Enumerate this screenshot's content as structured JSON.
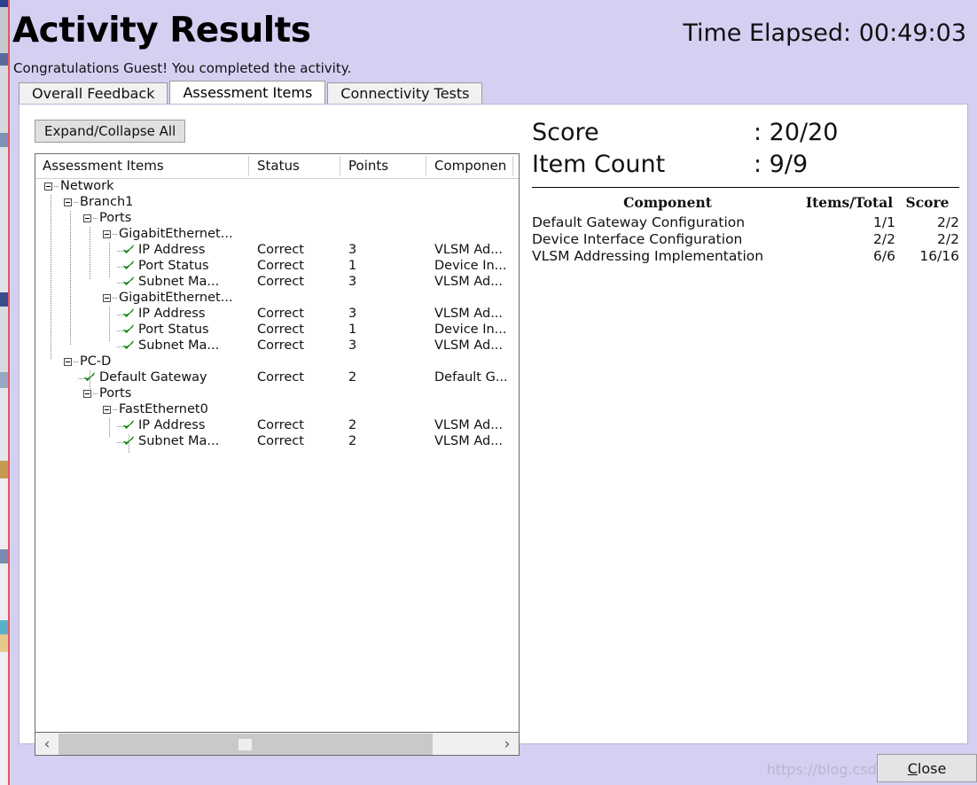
{
  "header": {
    "title": "Activity Results",
    "time_elapsed": "Time Elapsed: 00:49:03",
    "subtitle": "Congratulations Guest! You completed the activity."
  },
  "tabs": [
    {
      "label": "Overall Feedback",
      "active": false
    },
    {
      "label": "Assessment Items",
      "active": true
    },
    {
      "label": "Connectivity Tests",
      "active": false
    }
  ],
  "toolbar": {
    "expand_collapse_label": "Expand/Collapse All"
  },
  "tree": {
    "columns": [
      {
        "label": "Assessment Items"
      },
      {
        "label": "Status"
      },
      {
        "label": "Points"
      },
      {
        "label": "Componen"
      }
    ],
    "rows": [
      {
        "label": "Network",
        "depth": 0,
        "kind": "node"
      },
      {
        "label": "Branch1",
        "depth": 1,
        "kind": "node"
      },
      {
        "label": "Ports",
        "depth": 2,
        "kind": "node"
      },
      {
        "label": "GigabitEthernet...",
        "depth": 3,
        "kind": "node"
      },
      {
        "label": "IP Address",
        "depth": 4,
        "kind": "leaf",
        "status": "Correct",
        "points": "3",
        "component": "VLSM Ad..."
      },
      {
        "label": "Port Status",
        "depth": 4,
        "kind": "leaf",
        "status": "Correct",
        "points": "1",
        "component": "Device In..."
      },
      {
        "label": "Subnet Ma...",
        "depth": 4,
        "kind": "leaf",
        "status": "Correct",
        "points": "3",
        "component": "VLSM Ad..."
      },
      {
        "label": "GigabitEthernet...",
        "depth": 3,
        "kind": "node"
      },
      {
        "label": "IP Address",
        "depth": 4,
        "kind": "leaf",
        "status": "Correct",
        "points": "3",
        "component": "VLSM Ad..."
      },
      {
        "label": "Port Status",
        "depth": 4,
        "kind": "leaf",
        "status": "Correct",
        "points": "1",
        "component": "Device In..."
      },
      {
        "label": "Subnet Ma...",
        "depth": 4,
        "kind": "leaf",
        "status": "Correct",
        "points": "3",
        "component": "VLSM Ad..."
      },
      {
        "label": "PC-D",
        "depth": 1,
        "kind": "node"
      },
      {
        "label": "Default Gateway",
        "depth": 2,
        "kind": "leaf",
        "status": "Correct",
        "points": "2",
        "component": "Default G..."
      },
      {
        "label": "Ports",
        "depth": 2,
        "kind": "node"
      },
      {
        "label": "FastEthernet0",
        "depth": 3,
        "kind": "node"
      },
      {
        "label": "IP Address",
        "depth": 4,
        "kind": "leaf",
        "status": "Correct",
        "points": "2",
        "component": "VLSM Ad..."
      },
      {
        "label": "Subnet Ma...",
        "depth": 4,
        "kind": "leaf",
        "status": "Correct",
        "points": "2",
        "component": "VLSM Ad..."
      }
    ]
  },
  "scrollbar": {
    "left_arrow": "‹",
    "right_arrow": "›"
  },
  "summary": {
    "score_label": "Score",
    "score_value": ": 20/20",
    "item_count_label": "Item Count",
    "item_count_value": ": 9/9",
    "table": {
      "headers": [
        "Component",
        "Items/Total",
        "Score"
      ],
      "rows": [
        {
          "component": "Default Gateway Configuration",
          "items": "1/1",
          "score": "2/2"
        },
        {
          "component": "Device Interface Configuration",
          "items": "2/2",
          "score": "2/2"
        },
        {
          "component": "VLSM Addressing Implementation",
          "items": "6/6",
          "score": "16/16"
        }
      ]
    }
  },
  "footer": {
    "close_mnemonic": "C",
    "close_rest": "lose",
    "watermark": "https://blog.csdn.net/QijunYe"
  }
}
